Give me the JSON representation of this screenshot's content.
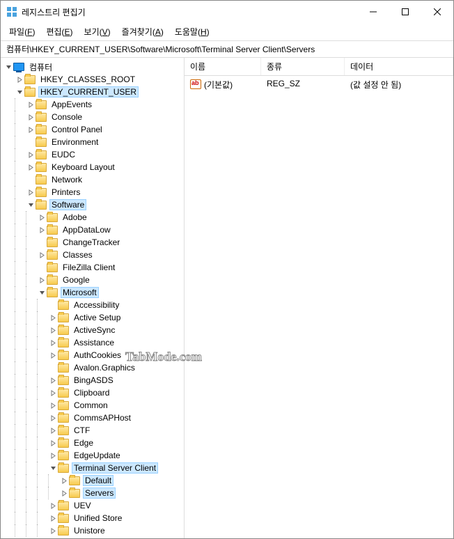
{
  "title": "레지스트리 편집기",
  "menu": {
    "file": "파일",
    "file_u": "F",
    "edit": "편집",
    "edit_u": "E",
    "view": "보기",
    "view_u": "V",
    "fav": "즐겨찾기",
    "fav_u": "A",
    "help": "도움말",
    "help_u": "H"
  },
  "address": "컴퓨터\\HKEY_CURRENT_USER\\Software\\Microsoft\\Terminal Server Client\\Servers",
  "list": {
    "col_name": "이름",
    "col_type": "종류",
    "col_data": "데이터",
    "row_name": "(기본값)",
    "row_type": "REG_SZ",
    "row_data": "(값 설정 안 됨)"
  },
  "tree": {
    "root": "컴퓨터",
    "hkcr": "HKEY_CLASSES_ROOT",
    "hkcu": "HKEY_CURRENT_USER",
    "appevents": "AppEvents",
    "console": "Console",
    "cpanel": "Control Panel",
    "env": "Environment",
    "eudc": "EUDC",
    "kbd": "Keyboard Layout",
    "network": "Network",
    "printers": "Printers",
    "software": "Software",
    "adobe": "Adobe",
    "appdatalow": "AppDataLow",
    "changetracker": "ChangeTracker",
    "classes": "Classes",
    "filezilla": "FileZilla Client",
    "google": "Google",
    "microsoft": "Microsoft",
    "accessibility": "Accessibility",
    "activesetup": "Active Setup",
    "activesync": "ActiveSync",
    "assistance": "Assistance",
    "authcookies": "AuthCookies",
    "avalon": "Avalon.Graphics",
    "bingasds": "BingASDS",
    "clipboard": "Clipboard",
    "common": "Common",
    "commsaphost": "CommsAPHost",
    "ctf": "CTF",
    "edge": "Edge",
    "edgeupdate": "EdgeUpdate",
    "tsc": "Terminal Server Client",
    "default": "Default",
    "servers": "Servers",
    "uev": "UEV",
    "unifiedstore": "Unified Store",
    "unistore": "Unistore"
  },
  "watermark": "TabMode.com"
}
